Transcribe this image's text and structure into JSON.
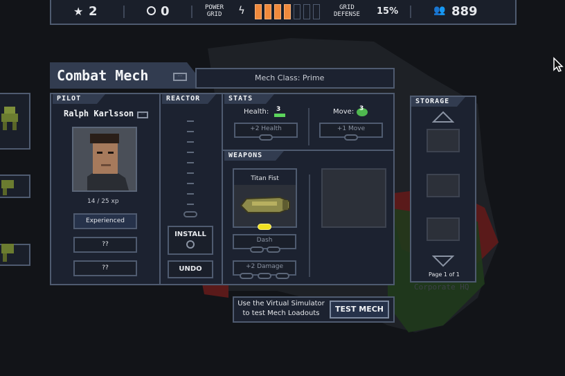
{
  "topbar": {
    "stars": "2",
    "reputation": "0",
    "power_grid_label_1": "POWER",
    "power_grid_label_2": "GRID",
    "power_grid_filled": 4,
    "power_grid_total": 7,
    "grid_defense_label_1": "GRID",
    "grid_defense_label_2": "DEFENSE",
    "grid_defense_value": "15%",
    "population": "889"
  },
  "mech": {
    "title": "Combat Mech",
    "class_label": "Mech Class: Prime"
  },
  "pilot": {
    "header": "PILOT",
    "name": "Ralph Karlsson",
    "xp": "14 / 25 xp",
    "skill_1": "Experienced",
    "skill_2": "??",
    "skill_3": "??"
  },
  "reactor": {
    "header": "REACTOR",
    "install_label": "INSTALL",
    "undo_label": "UNDO"
  },
  "stats": {
    "header": "STATS",
    "health_label": "Health:",
    "health_value": "3",
    "health_upgrade": "+2 Health",
    "move_label": "Move:",
    "move_value": "3",
    "move_upgrade": "+1 Move"
  },
  "weapons": {
    "header": "WEAPONS",
    "weapon_name": "Titan Fist",
    "upgrade_1": "Dash",
    "upgrade_2": "+2 Damage"
  },
  "storage": {
    "header": "STORAGE",
    "page": "Page 1 of 1"
  },
  "simulator": {
    "text_1": "Use the Virtual Simulator",
    "text_2": "to test Mech Loadouts",
    "button": "TEST MECH"
  },
  "map_label": "Corporate HQ",
  "colors": {
    "power_fill": "#f08a3c",
    "health_green": "#5cd65c",
    "move_green": "#4fb84f",
    "accent_yellow": "#f0e020",
    "map_red": "#5a1a1a",
    "map_green": "#1f3a1c"
  }
}
